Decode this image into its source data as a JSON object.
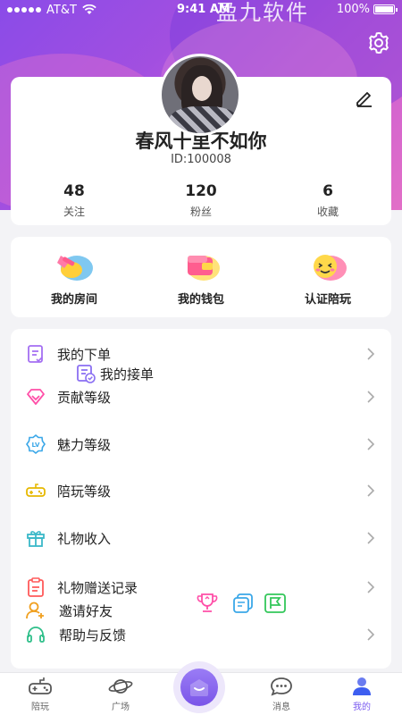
{
  "status": {
    "carrier": "AT&T",
    "time": "9:41 AM",
    "battery": "100%",
    "watermark": "盈九软件"
  },
  "profile": {
    "nickname": "春风十里不如你",
    "id": "ID:100008",
    "stats": [
      {
        "value": "48",
        "label": "关注"
      },
      {
        "value": "120",
        "label": "粉丝"
      },
      {
        "value": "6",
        "label": "收藏"
      }
    ]
  },
  "quick": [
    {
      "label": "我的房间",
      "icon": "room-icon"
    },
    {
      "label": "我的钱包",
      "icon": "wallet-icon"
    },
    {
      "label": "认证陪玩",
      "icon": "certify-icon"
    }
  ],
  "menu": {
    "orders": "我的下单",
    "received": "我的接单",
    "contribution": "贡献等级",
    "charm": "魅力等级",
    "companion": "陪玩等级",
    "gift_income": "礼物收入",
    "gift_record": "礼物赠送记录",
    "invite": "邀请好友",
    "help": "帮助与反馈"
  },
  "tabs": [
    {
      "label": "陪玩",
      "icon": "gamepad-icon"
    },
    {
      "label": "广场",
      "icon": "planet-icon"
    },
    {
      "label": "",
      "icon": "home-center-icon"
    },
    {
      "label": "消息",
      "icon": "chat-icon"
    },
    {
      "label": "我的",
      "icon": "user-icon"
    }
  ],
  "colors": {
    "accent": "#7b5cf0",
    "hero_start": "#8a4be8",
    "hero_end": "#e26fc7"
  }
}
